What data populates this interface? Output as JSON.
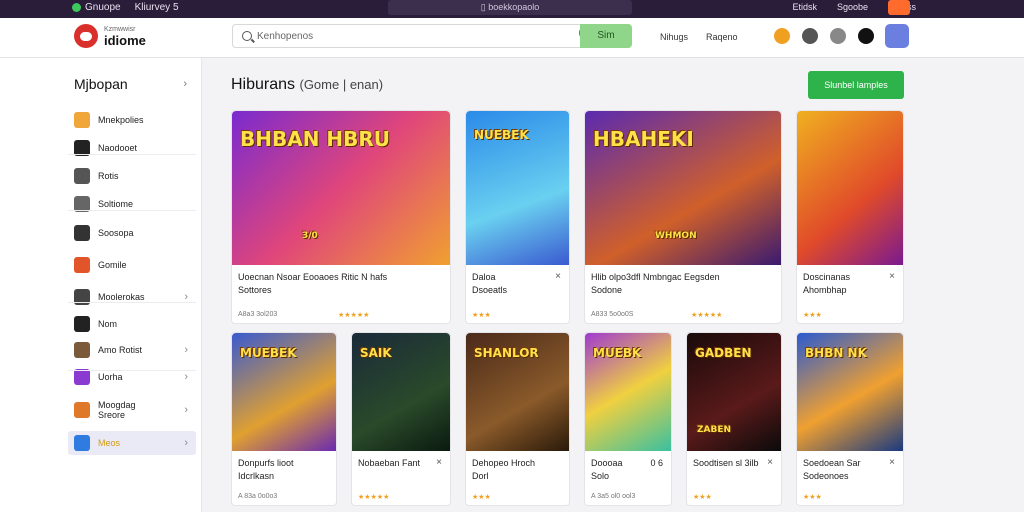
{
  "topbar": {
    "left_items": [
      "Gnuope",
      "Kliurvey 5",
      "5"
    ],
    "address": "boekkopaolo",
    "right_items": [
      "Etidsk",
      "Sgoobe",
      "C0 nss"
    ]
  },
  "header": {
    "logo_small": "Kzmwwisr",
    "logo_name": "idiome",
    "search_placeholder": "Kenhopenos",
    "search_button": "Sim",
    "links": [
      "Nihugs",
      "Raqeno"
    ]
  },
  "sidebar": {
    "title": "Mjbopan",
    "items": [
      {
        "label": "Mnekpolies",
        "color": "#f1a63a",
        "chevron": false
      },
      {
        "label": "Naodooet",
        "color": "#222222",
        "chevron": false
      },
      {
        "label": "Rotis",
        "color": "#555555",
        "chevron": false
      },
      {
        "label": "Soltiome",
        "color": "#666666",
        "chevron": false
      },
      {
        "label": "Soosopa",
        "color": "#333333",
        "chevron": false
      },
      {
        "label": "Gomile",
        "color": "#e2542a",
        "chevron": false
      },
      {
        "label": "Moolerokas",
        "color": "#444444",
        "chevron": true
      },
      {
        "label": "Nom",
        "color": "#222222",
        "chevron": false
      },
      {
        "label": "Amo Rotist",
        "color": "#7a5a3a",
        "chevron": true
      },
      {
        "label": "Uorha",
        "color": "#8a3ad0",
        "chevron": true
      },
      {
        "label": "Moogdag",
        "label2": "Sreore",
        "color": "#e0782a",
        "chevron": true
      },
      {
        "label": "Meos",
        "color": "#2f7be0",
        "chevron": true,
        "active": true
      }
    ]
  },
  "main": {
    "title": "Hiburans",
    "title_sub": "(Gome | enan)",
    "primary_button": "Slunbel lamples"
  },
  "cards_row1": [
    {
      "art": "BHBAN HBRU",
      "art_sub": "3/0",
      "line1": "Uoecnan Nsoar Eooaoes Ritic N hafs",
      "line2": "Sottores",
      "meta": "A8a3 3ol203",
      "stars": "★★★★★",
      "close": false
    },
    {
      "art": "NUEBEK",
      "line1": "Daloa",
      "line2": "Dsoeatls",
      "meta": "",
      "stars": "★★★",
      "close": true
    },
    {
      "art": "HBAHEKI",
      "art_sub": "WHMON",
      "line1": "Hlib olpo3dfl Nmbngac Eegsden",
      "line2": "Sodone",
      "meta": "A833 5o0o0S",
      "stars": "★★★★★",
      "close": false
    },
    {
      "art": "",
      "line1": "Doscinanas",
      "line2": "Ahombhap",
      "meta": "",
      "stars": "★★★",
      "close": true
    }
  ],
  "cards_row2": [
    {
      "art": "MUEBEK",
      "line1": "Donpurfs lioot",
      "line2": "Idcrlkasn",
      "meta": "A 83a 0o0o3",
      "stars": "",
      "close": false
    },
    {
      "art": "SAIK",
      "line1": "Nobaeban Fant",
      "line2": "",
      "meta": "",
      "stars": "★★★★★",
      "close": true
    },
    {
      "art": "SHANLOR",
      "line1": "Dehopeo Hroch",
      "line2": "Dorl",
      "meta": "",
      "stars": "★★★",
      "close": false
    },
    {
      "art": "MUEBK",
      "line1": "Doooaa",
      "line2": "Solo",
      "side": "0 6",
      "meta": "A 3a5 ol0 ool3",
      "stars": "",
      "close": false
    },
    {
      "art": "GADBEN",
      "art_sub": "ZABEN",
      "line1": "Soodtisen sl 3ilb",
      "line2": "",
      "meta": "",
      "stars": "★★★",
      "close": true
    },
    {
      "art": "BHBN NK",
      "line1": "Soedoean Sar",
      "line2": "Sodeonoes",
      "meta": "",
      "stars": "★★★",
      "close": true
    }
  ],
  "colors": {
    "accent_green": "#2db34a",
    "topbar": "#2a1d3a",
    "star": "#f0a020",
    "active_label": "#d49b12"
  }
}
